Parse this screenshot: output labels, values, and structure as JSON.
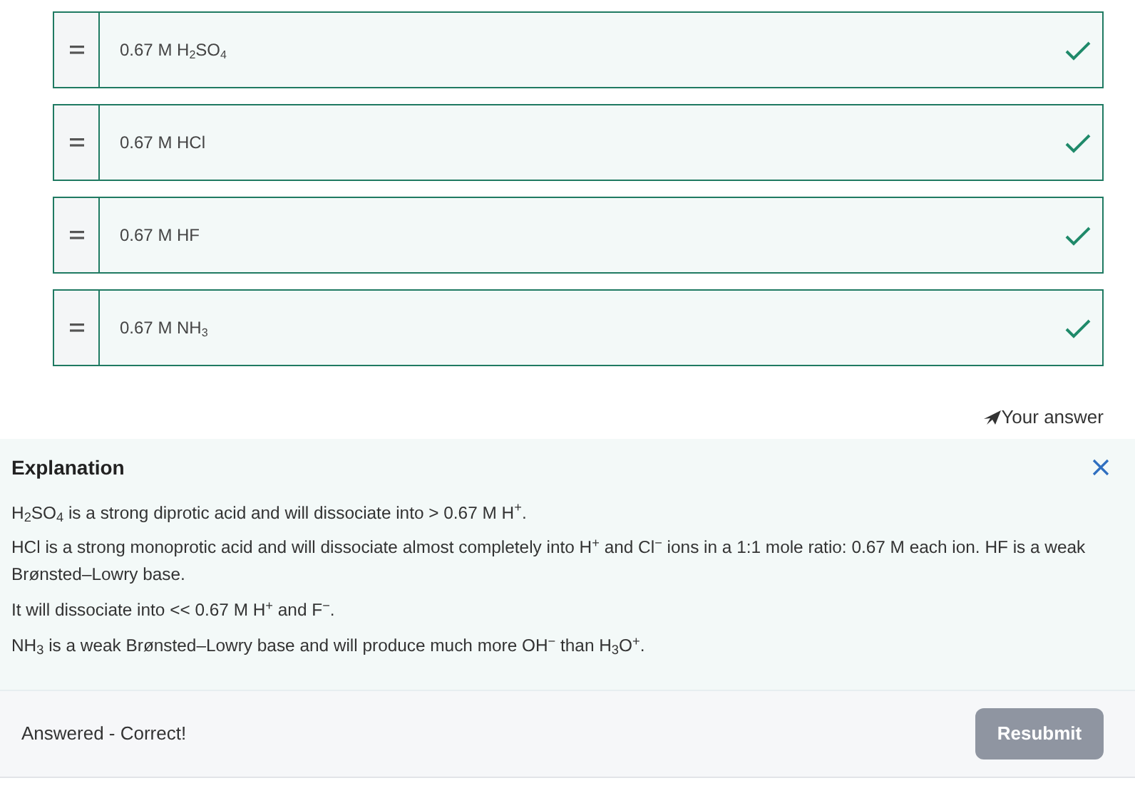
{
  "answers": [
    {
      "label": "0.67 M H$_{2}$SO$_{4}$",
      "correct": true
    },
    {
      "label": "0.67 M HCl",
      "correct": true
    },
    {
      "label": "0.67 M HF",
      "correct": true
    },
    {
      "label": "0.67 M NH$_{3}$",
      "correct": true
    }
  ],
  "your_answer": "Your answer",
  "explanation": {
    "title": "Explanation",
    "paragraphs": [
      "H$_{2}$SO$_{4}$ is a strong diprotic acid and will dissociate into > 0.67 M H$^{+}$.",
      "HCl is a strong monoprotic acid and will dissociate almost completely into H$^{+}$ and Cl$^{−}$ ions in a 1:1 mole ratio: 0.67 M each ion. HF is a weak Brønsted–Lowry base.",
      "It will dissociate into << 0.67 M H$^{+}$ and F$^{−}$.",
      "NH$_{3}$ is a weak Brønsted–Lowry base and will produce much more OH$^{−}$ than H$_{3}$O$^{+}$."
    ]
  },
  "status": "Answered - Correct!",
  "resubmit": {
    "label": "Resubmit",
    "disabled": true
  }
}
